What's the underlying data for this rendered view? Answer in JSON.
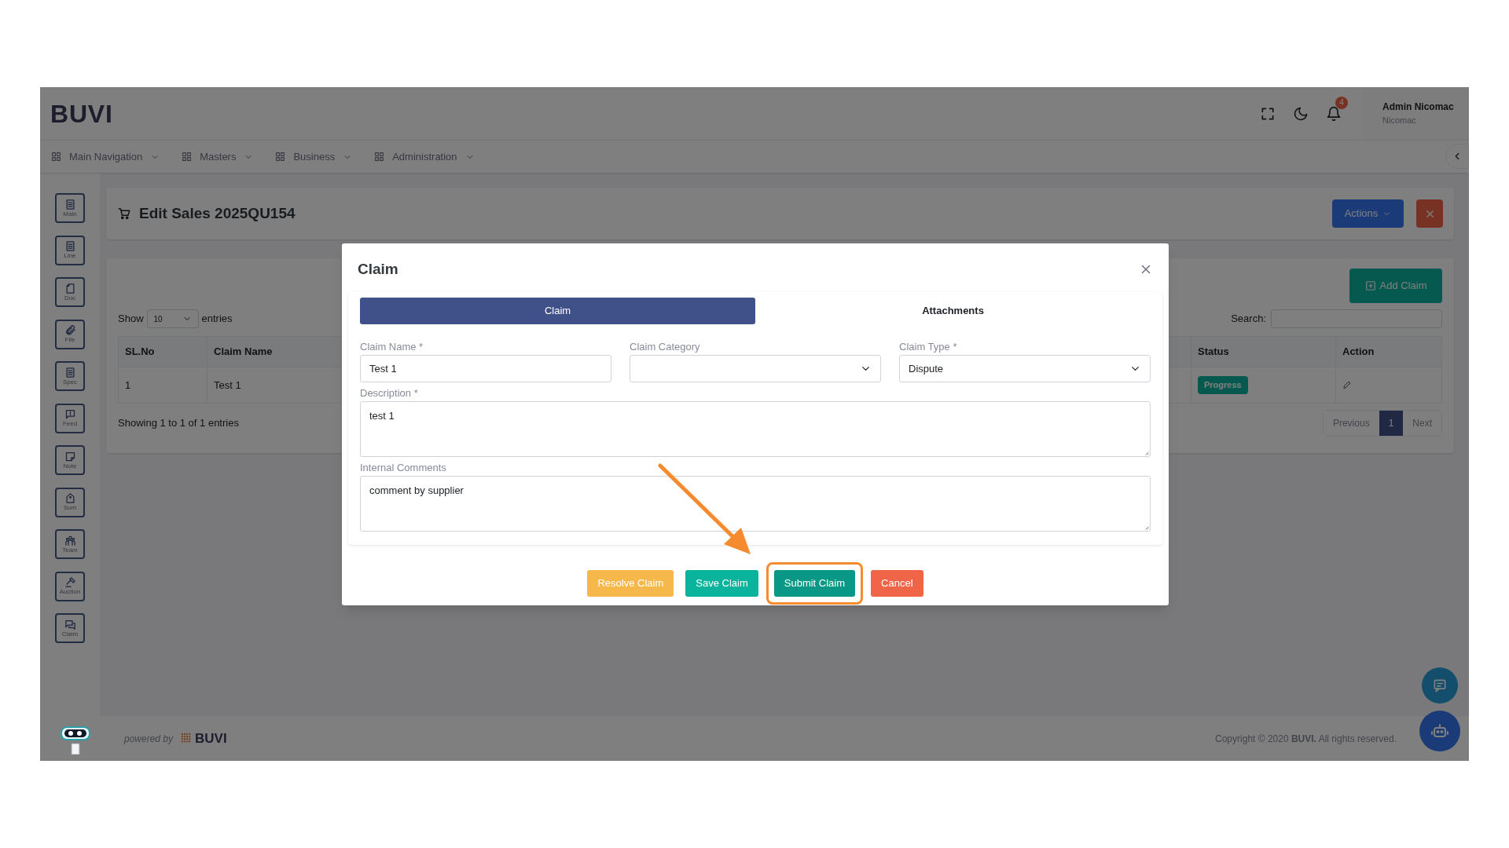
{
  "header": {
    "logo": "BUVI",
    "notification_count": "4",
    "user": {
      "name": "Admin Nicomac",
      "company": "Nicomac"
    }
  },
  "nav": [
    {
      "label": "Main Navigation"
    },
    {
      "label": "Masters"
    },
    {
      "label": "Business"
    },
    {
      "label": "Administration"
    }
  ],
  "sidebar": [
    {
      "label": "Main"
    },
    {
      "label": "Line"
    },
    {
      "label": "Doc"
    },
    {
      "label": "File"
    },
    {
      "label": "Spec"
    },
    {
      "label": "Feed"
    },
    {
      "label": "Note"
    },
    {
      "label": "Sum"
    },
    {
      "label": "Team"
    },
    {
      "label": "Auction"
    },
    {
      "label": "Claim"
    }
  ],
  "page": {
    "title": "Edit Sales 2025QU154",
    "actions_button": "Actions"
  },
  "table_panel": {
    "add_button": "Add Claim",
    "show_label": "Show",
    "page_size": "10",
    "entries_label": "entries",
    "search_label": "Search:",
    "columns": [
      "SL.No",
      "Claim Name",
      "Status",
      "Action"
    ],
    "rows": [
      {
        "sl_no": "1",
        "claim_name": "Test 1",
        "status": "Progress"
      }
    ],
    "info": "Showing 1 to 1 of 1 entries",
    "pagination": [
      {
        "label": "Previous",
        "selected": false
      },
      {
        "label": "1",
        "selected": true
      },
      {
        "label": "Next",
        "selected": false
      }
    ]
  },
  "modal": {
    "title": "Claim",
    "tabs": [
      {
        "label": "Claim",
        "selected": true
      },
      {
        "label": "Attachments",
        "selected": false
      }
    ],
    "fields": [
      {
        "kind": "text",
        "label": "Claim Name *",
        "value": "Test 1"
      },
      {
        "kind": "select",
        "label": "Claim Category"
      },
      {
        "kind": "select",
        "label": "Claim Type *",
        "value": "Dispute"
      }
    ],
    "textareas": [
      {
        "label": "Description *",
        "value": "test 1"
      },
      {
        "label": "Internal Comments",
        "value": "comment by supplier"
      }
    ],
    "buttons": [
      {
        "label": "Resolve Claim",
        "kind": "warning",
        "highlighted": false
      },
      {
        "label": "Save Claim",
        "kind": "success",
        "highlighted": false
      },
      {
        "label": "Submit Claim",
        "kind": "submit",
        "highlighted": true
      },
      {
        "label": "Cancel",
        "kind": "danger",
        "highlighted": false
      }
    ]
  },
  "footer": {
    "powered_by": "powered by",
    "brand": "BUVI",
    "copyright": "Copyright © 2020 **BUVI.** All rights reserved."
  }
}
